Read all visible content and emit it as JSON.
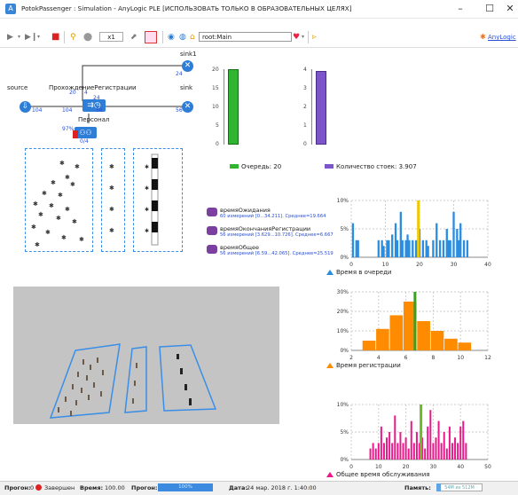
{
  "window": {
    "title": "PotokPassenger : Simulation - AnyLogic PLE [ИСПОЛЬЗОВАТЬ ТОЛЬКО В ОБРАЗОВАТЕЛЬНЫХ ЦЕЛЯХ]",
    "minimize": "–",
    "maximize": "☐",
    "close": "✕"
  },
  "toolbar": {
    "speed": "x1",
    "root_combo": "root:Main",
    "brand": "AnyLogic"
  },
  "flowchart": {
    "sink1_label": "sink1",
    "sink1_count": "24",
    "source_label": "source",
    "source_count": "104",
    "passage_label": "ПрохождениеРегистрации",
    "passage_top_in": "20",
    "passage_top_mid": "4",
    "passage_top_count": "24",
    "passage_in_count": "104",
    "passage_out_count": "56",
    "sink_label": "sink",
    "sink_count": "56",
    "staff_label": "Персонал",
    "staff_util": "97%",
    "staff_count": "0/4"
  },
  "bar_charts": {
    "queue": {
      "max_label": "20",
      "ticks": [
        "20",
        "15",
        "10",
        "5",
        "0"
      ],
      "legend": "Очередь: 20",
      "color": "#2fb52f"
    },
    "counters": {
      "ticks": [
        "4",
        "3",
        "2",
        "1",
        "0"
      ],
      "legend": "Количество стоек: 3.907",
      "color": "#7b55c9"
    }
  },
  "stats": [
    {
      "name": "времяОжидания",
      "detail": "60 измерений [0...34.211]. Среднее=19.664"
    },
    {
      "name": "времяОкончанияРегистрации",
      "detail": "56 измерений [3.629...10.726]. Среднее=6.667"
    },
    {
      "name": "времяОбщее",
      "detail": "56 измерений [6.59...42.065]. Среднее=25.519"
    }
  ],
  "chart_data": [
    {
      "type": "bar",
      "title": "Время в очереди",
      "color": "#2b8de0",
      "mean_color": "#f0c800",
      "mean": 19.664,
      "xlim": [
        0,
        40
      ],
      "xticks": [
        "0",
        "10",
        "20",
        "30",
        "40"
      ],
      "yticks": [
        "10%",
        "5%",
        "0%"
      ],
      "ylim": [
        0,
        10
      ],
      "x": [
        0.5,
        1.5,
        2,
        8,
        9,
        9.5,
        10.5,
        11,
        12,
        13,
        13.5,
        14.5,
        15,
        16,
        16.5,
        17,
        18,
        19,
        20,
        21,
        22,
        22.5,
        24,
        25,
        26,
        27,
        28,
        28.5,
        29,
        30,
        31,
        31.5,
        32,
        33,
        34
      ],
      "values": [
        6,
        3,
        3,
        3,
        3,
        2,
        3,
        3,
        4,
        6,
        3,
        8,
        3,
        3,
        4,
        3,
        3,
        3,
        5,
        3,
        3,
        2,
        3,
        6,
        3,
        3,
        5,
        3,
        3,
        8,
        5,
        3,
        6,
        3,
        3
      ]
    },
    {
      "type": "bar",
      "title": "Время регистрации",
      "color": "#ff8c00",
      "mean_color": "#3aa024",
      "mean": 6.667,
      "xlim": [
        2,
        12
      ],
      "xticks": [
        "2",
        "4",
        "6",
        "8",
        "10",
        "12"
      ],
      "yticks": [
        "30%",
        "20%",
        "10%",
        "0%"
      ],
      "ylim": [
        0,
        30
      ],
      "x": [
        3.3,
        4.3,
        5.3,
        6.3,
        7.3,
        8.3,
        9.3,
        10.3
      ],
      "values": [
        5,
        11,
        18,
        25,
        15,
        10,
        6,
        4
      ]
    },
    {
      "type": "bar",
      "title": "Общее время обслуживания",
      "color": "#e8198a",
      "mean_color": "#6cb92c",
      "mean": 25.519,
      "xlim": [
        0,
        50
      ],
      "xticks": [
        "0",
        "10",
        "20",
        "30",
        "40",
        "50"
      ],
      "yticks": [
        "10%",
        "5%",
        "0%"
      ],
      "ylim": [
        0,
        10
      ],
      "x": [
        7,
        8,
        9,
        10,
        11,
        12,
        13,
        14,
        15,
        16,
        17,
        18,
        19,
        20,
        21,
        22,
        23,
        24,
        25,
        26,
        27,
        28,
        29,
        30,
        31,
        32,
        33,
        34,
        35,
        36,
        37,
        38,
        39,
        40,
        41,
        42
      ],
      "values": [
        2,
        3,
        2,
        3,
        6,
        3,
        4,
        5,
        3,
        8,
        3,
        5,
        3,
        4,
        2,
        7,
        3,
        5,
        3,
        4,
        2,
        6,
        9,
        3,
        4,
        7,
        3,
        5,
        2,
        6,
        3,
        4,
        3,
        6,
        7,
        3
      ]
    }
  ],
  "status": {
    "run_label": "Прогон:",
    "run_value": "0",
    "state": "Завершен",
    "time_label": "Время:",
    "time_value": "100.00",
    "progress_label": "Прогон:",
    "progress_value": "100%",
    "date_label": "Дата:",
    "date_value": "24 мар. 2018 г. 1:40:00",
    "memory_label": "Память:",
    "memory_value": "54M из 512M"
  }
}
